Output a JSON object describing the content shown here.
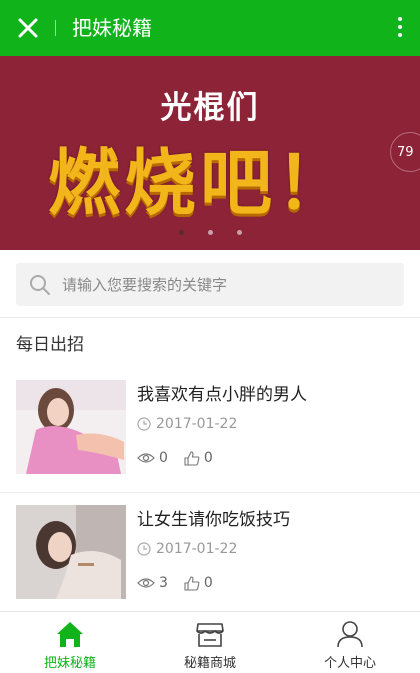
{
  "app": {
    "title": "把妹秘籍"
  },
  "banner": {
    "line1": "光棍们",
    "line2": "燃烧吧！",
    "badge": "79",
    "dots": 3,
    "active_dot": 0
  },
  "search": {
    "placeholder": "请输入您要搜索的关键字"
  },
  "section": {
    "title": "每日出招"
  },
  "articles": [
    {
      "title": "我喜欢有点小胖的男人",
      "date": "2017-01-22",
      "views": "0",
      "likes": "0"
    },
    {
      "title": "让女生请你吃饭技巧",
      "date": "2017-01-22",
      "views": "3",
      "likes": "0"
    }
  ],
  "tabs": [
    {
      "label": "把妹秘籍",
      "icon": "home-icon",
      "active": true
    },
    {
      "label": "秘籍商城",
      "icon": "shop-icon",
      "active": false
    },
    {
      "label": "个人中心",
      "icon": "user-icon",
      "active": false
    }
  ],
  "colors": {
    "brand": "#11b31a",
    "banner_bg": "#8d2337",
    "banner_text": "#f2b51a"
  }
}
